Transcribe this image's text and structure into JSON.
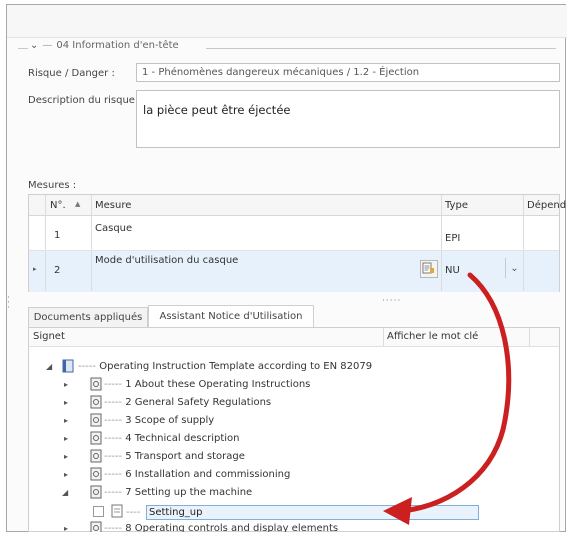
{
  "header": {
    "group_label": "04 Information d'en-tête",
    "risk_label": "Risque / Danger :",
    "risk_value": "1 - Phénomènes dangereux mécaniques / 1.2 - Éjection",
    "desc_label": "Description du risque :",
    "desc_value": "la pièce peut être éjectée"
  },
  "measures": {
    "label": "Mesures :",
    "columns": [
      "N°.",
      "Mesure",
      "Type",
      "Dépend"
    ],
    "rows": [
      {
        "num": "1",
        "mesure": "Casque",
        "type": "EPI"
      },
      {
        "num": "2",
        "mesure": "Mode d'utilisation du casque",
        "type": "NU"
      }
    ]
  },
  "tabs": [
    "Documents appliqués",
    "Assistant Notice d'Utilisation"
  ],
  "tree": {
    "col_signet": "Signet",
    "col_keyword": "Afficher le mot clé",
    "root": "Operating Instruction Template according to EN 82079",
    "items": [
      "1 About these Operating Instructions",
      "2 General Safety Regulations",
      "3 Scope of supply",
      "4 Technical description",
      "5 Transport and storage",
      "6 Installation and commissioning",
      "7 Setting up the machine"
    ],
    "editing": "Setting_up",
    "next_item": "8 Operating controls and display elements"
  },
  "colors": {
    "arrow": "#cc1f1f",
    "selection": "#e6f1fb",
    "edit_border": "#7fb0dd"
  }
}
